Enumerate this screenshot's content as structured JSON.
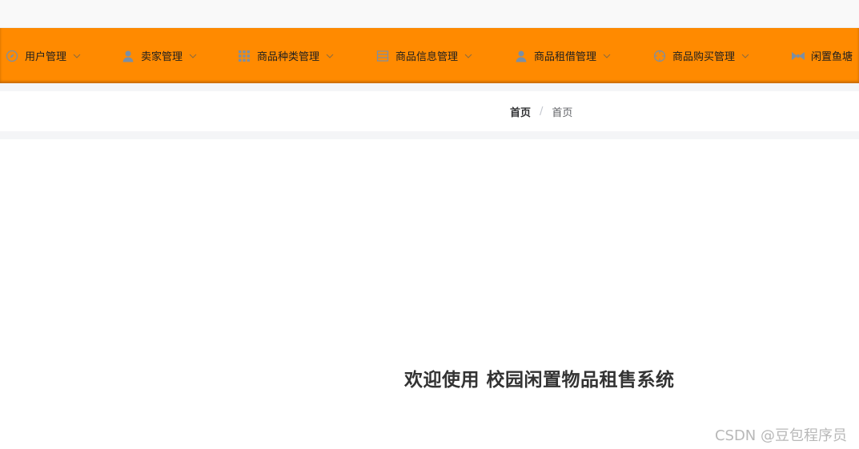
{
  "nav": {
    "items": [
      {
        "label": "用户管理",
        "icon": "compass-icon"
      },
      {
        "label": "卖家管理",
        "icon": "user-icon"
      },
      {
        "label": "商品种类管理",
        "icon": "grid-icon"
      },
      {
        "label": "商品信息管理",
        "icon": "list-icon"
      },
      {
        "label": "商品租借管理",
        "icon": "user-icon"
      },
      {
        "label": "商品购买管理",
        "icon": "crosshair-icon"
      },
      {
        "label": "闲置鱼塘",
        "icon": "bowtie-icon"
      }
    ],
    "colors": {
      "background": "#ff8a00",
      "text": "#1f1f1f",
      "icon": "#7a8fa6"
    }
  },
  "breadcrumb": {
    "home": "首页",
    "separator": "/",
    "current": "首页"
  },
  "main": {
    "welcome": "欢迎使用 校园闲置物品租售系统"
  },
  "watermark": "CSDN @豆包程序员"
}
